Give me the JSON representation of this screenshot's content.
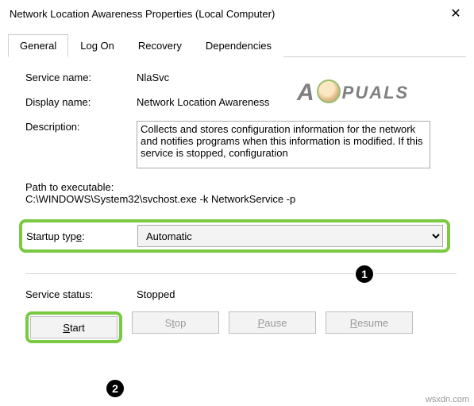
{
  "window": {
    "title": "Network Location Awareness Properties (Local Computer)"
  },
  "tabs": {
    "general": "General",
    "logon": "Log On",
    "recovery": "Recovery",
    "dependencies": "Dependencies"
  },
  "labels": {
    "service_name": "Service name:",
    "display_name": "Display name:",
    "description": "Description:",
    "path": "Path to executable:",
    "startup_type": "Startup type:",
    "service_status": "Service status:"
  },
  "values": {
    "service_name": "NlaSvc",
    "display_name": "Network Location Awareness",
    "description": "Collects and stores configuration information for the network and notifies programs when this information is modified. If this service is stopped, configuration",
    "path": "C:\\WINDOWS\\System32\\svchost.exe -k NetworkService -p",
    "startup_type": "Automatic",
    "service_status": "Stopped"
  },
  "buttons": {
    "start": "Start",
    "stop": "Stop",
    "pause": "Pause",
    "resume": "Resume"
  },
  "annotations": {
    "badge1": "1",
    "badge2": "2"
  },
  "watermark": {
    "part1": "A",
    "part2": "PUALS"
  },
  "footer": "wsxdn.com"
}
